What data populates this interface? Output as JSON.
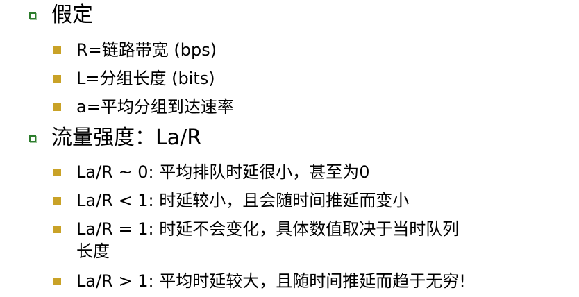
{
  "items": [
    {
      "level": 1,
      "text": "假定"
    },
    {
      "level": 2,
      "text": "R=链路带宽 (bps)"
    },
    {
      "level": 2,
      "text": "L=分组长度 (bits)"
    },
    {
      "level": 2,
      "text": "a=平均分组到达速率"
    },
    {
      "level": 1,
      "text": "流量强度：La/R"
    },
    {
      "level": 2,
      "text": "La/R ~ 0: 平均排队时延很小，甚至为0"
    },
    {
      "level": 2,
      "text": "La/R < 1: 时延较小，且会随时间推延而变小"
    },
    {
      "level": 2,
      "text": "La/R = 1: 时延不会变化，具体数值取决于当时队列"
    },
    {
      "level": 2,
      "text": "长度"
    },
    {
      "level": 2,
      "text": "La/R > 1: 平均时延较大，且随时间推延而趋于无穷!"
    }
  ],
  "colors": {
    "level1_bullet": "#2d7d2d",
    "level2_bullet": "#c9a227",
    "text": "#000000"
  }
}
